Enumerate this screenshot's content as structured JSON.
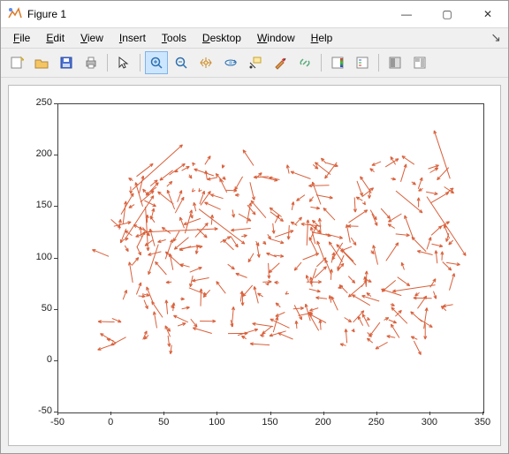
{
  "window": {
    "title": "Figure 1",
    "buttons": {
      "min": "—",
      "max": "▢",
      "close": "✕"
    }
  },
  "menus": [
    "File",
    "Edit",
    "View",
    "Insert",
    "Tools",
    "Desktop",
    "Window",
    "Help"
  ],
  "toolbar_icons": [
    "new-figure",
    "open",
    "save",
    "print",
    "|",
    "pointer",
    "|",
    "zoom-in",
    "zoom-out",
    "pan",
    "rotate-3d",
    "data-cursor",
    "brush",
    "link",
    "|",
    "insert-colorbar",
    "insert-legend",
    "|",
    "hide-toolbar",
    "dock"
  ],
  "chart_data": {
    "type": "quiver",
    "title": "",
    "xlabel": "",
    "ylabel": "",
    "xlim": [
      -50,
      350
    ],
    "ylim": [
      -50,
      250
    ],
    "xticks": [
      -50,
      0,
      50,
      100,
      150,
      200,
      250,
      300,
      350
    ],
    "yticks": [
      -50,
      0,
      50,
      100,
      150,
      200,
      250
    ],
    "arrow_color": "#d9603b",
    "approx_arrow_count": 350,
    "note": "Dense field of short orange arrows; origins concentrated in irregular blob roughly x∈[0,320], y∈[20,190]; directions mixed with slight upward bias; a few long outlier arrows. Exact per-arrow data not individually readable from raster."
  }
}
